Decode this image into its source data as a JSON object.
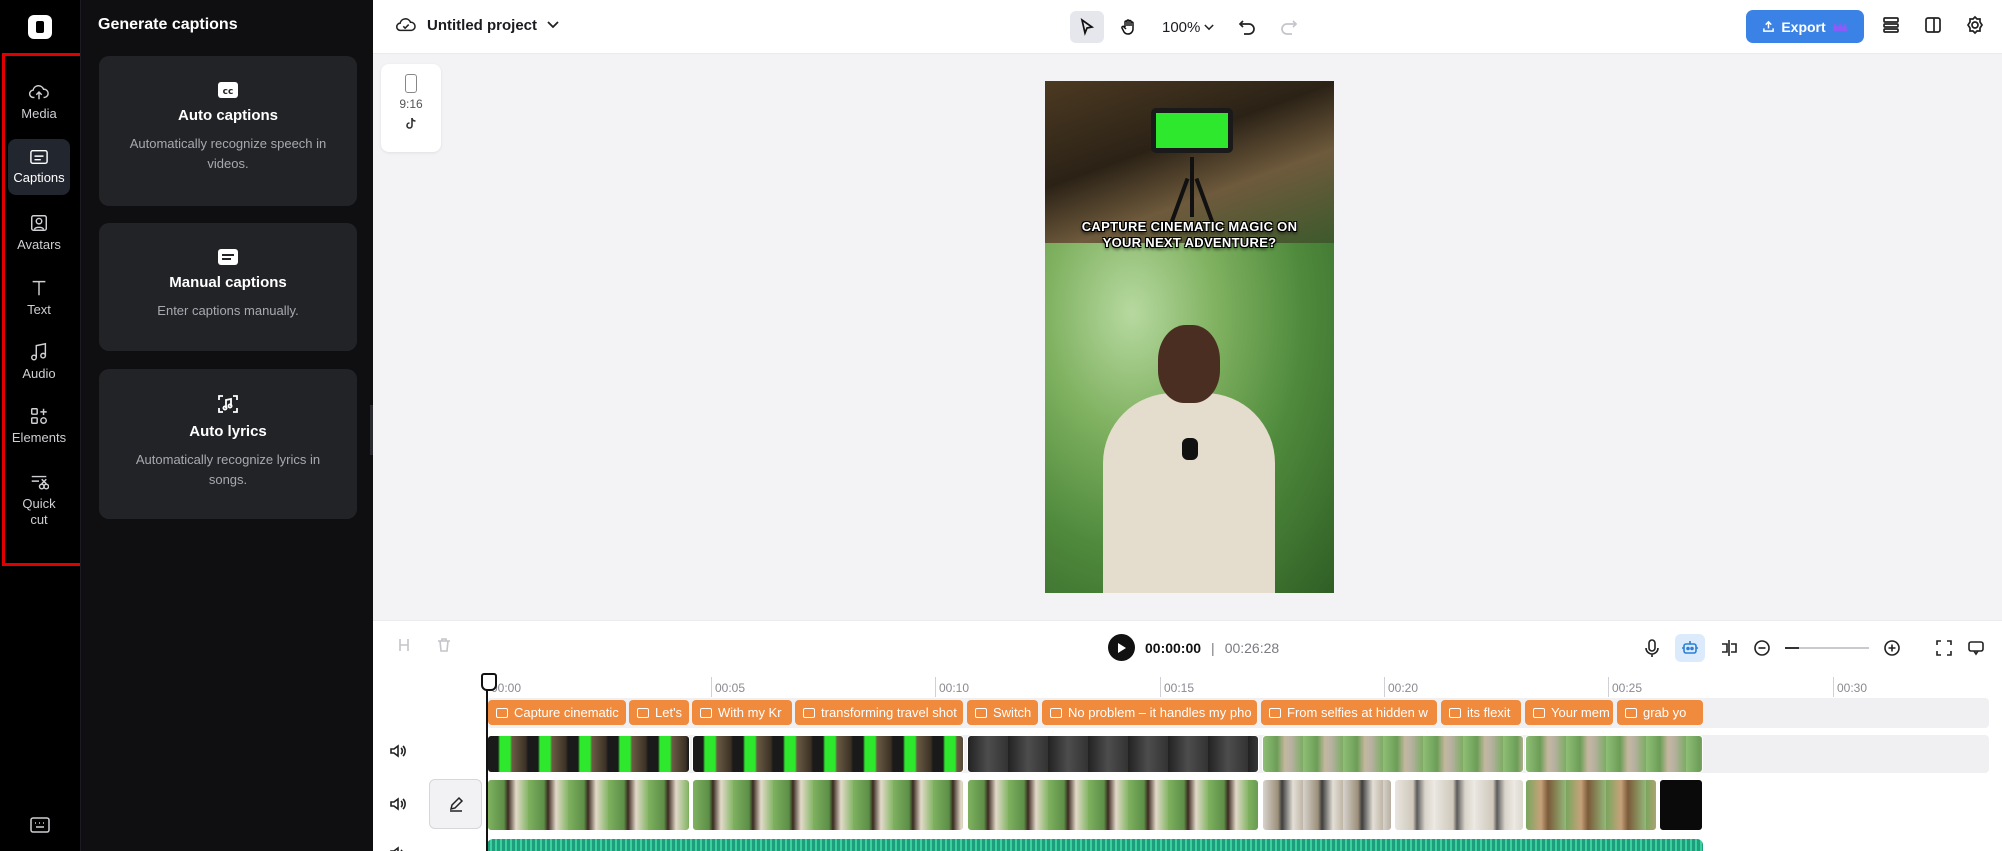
{
  "rail": {
    "items": [
      {
        "label": "Media"
      },
      {
        "label": "Captions"
      },
      {
        "label": "Avatars"
      },
      {
        "label": "Text"
      },
      {
        "label": "Audio"
      },
      {
        "label": "Elements"
      },
      {
        "label": "Quick cut"
      }
    ],
    "active": "Captions"
  },
  "panel": {
    "title": "Generate captions",
    "cards": [
      {
        "title": "Auto captions",
        "desc": "Automatically recognize speech in videos.",
        "icon": "cc-icon"
      },
      {
        "title": "Manual captions",
        "desc": "Enter captions manually.",
        "icon": "keyboard-caption-icon"
      },
      {
        "title": "Auto lyrics",
        "desc": "Automatically recognize lyrics in songs.",
        "icon": "lyrics-scan-icon"
      }
    ]
  },
  "topbar": {
    "project_title": "Untitled project",
    "zoom": "100%",
    "export_label": "Export"
  },
  "canvas": {
    "ratio_label": "9:16",
    "video_caption": "CAPTURE CINEMATIC MAGIC ON YOUR NEXT ADVENTURE?"
  },
  "timeline": {
    "current_time": "00:00:00",
    "separator": "|",
    "total_time": "00:26:28",
    "ticks": [
      "00:00",
      "00:05",
      "00:10",
      "00:15",
      "00:20",
      "00:25",
      "00:30"
    ],
    "captions": [
      "Capture cinematic",
      "Let's",
      "With my Kr",
      "transforming travel shot",
      "Switch",
      "No problem – it handles my pho",
      "From selfies at hidden w",
      "its flexit",
      "Your mem",
      "grab yo"
    ]
  },
  "colors": {
    "accent": "#3b82e6",
    "caption_chip": "#f08a3c",
    "audio_wave": "#1e9e7c",
    "highlight_box": "#e00000"
  }
}
